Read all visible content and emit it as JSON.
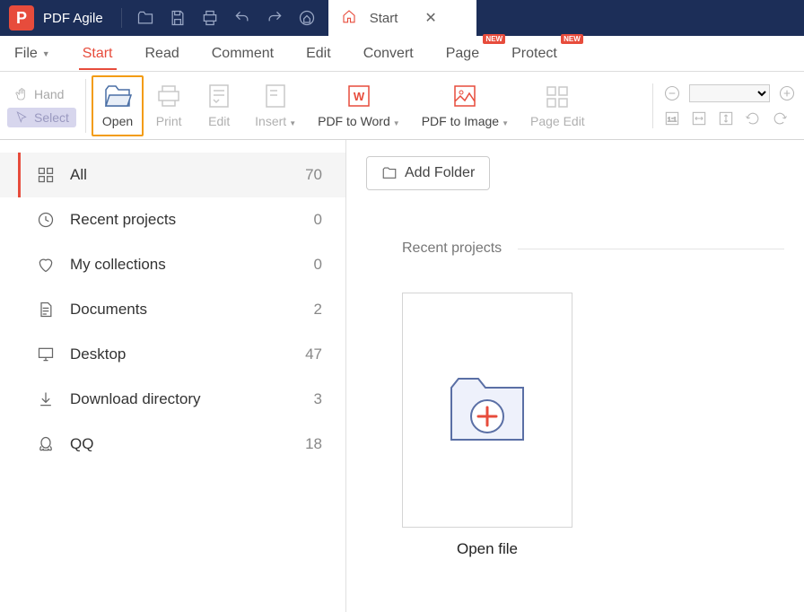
{
  "app": {
    "logo_letter": "P",
    "name": "PDF Agile"
  },
  "tab": {
    "label": "Start",
    "close": "✕"
  },
  "menu": {
    "file": "File",
    "start": "Start",
    "read": "Read",
    "comment": "Comment",
    "edit": "Edit",
    "convert": "Convert",
    "page": "Page",
    "protect": "Protect",
    "new_badge": "NEW"
  },
  "ribbon": {
    "hand": "Hand",
    "select": "Select",
    "open": "Open",
    "print": "Print",
    "edit": "Edit",
    "insert": "Insert",
    "pdf_to_word": "PDF to Word",
    "pdf_to_image": "PDF to Image",
    "page_edit": "Page Edit"
  },
  "sidebar": {
    "items": [
      {
        "label": "All",
        "count": "70"
      },
      {
        "label": "Recent projects",
        "count": "0"
      },
      {
        "label": "My collections",
        "count": "0"
      },
      {
        "label": "Documents",
        "count": "2"
      },
      {
        "label": "Desktop",
        "count": "47"
      },
      {
        "label": "Download directory",
        "count": "3"
      },
      {
        "label": "QQ",
        "count": "18"
      }
    ]
  },
  "main": {
    "add_folder": "Add Folder",
    "section": "Recent projects",
    "open_file": "Open file"
  }
}
